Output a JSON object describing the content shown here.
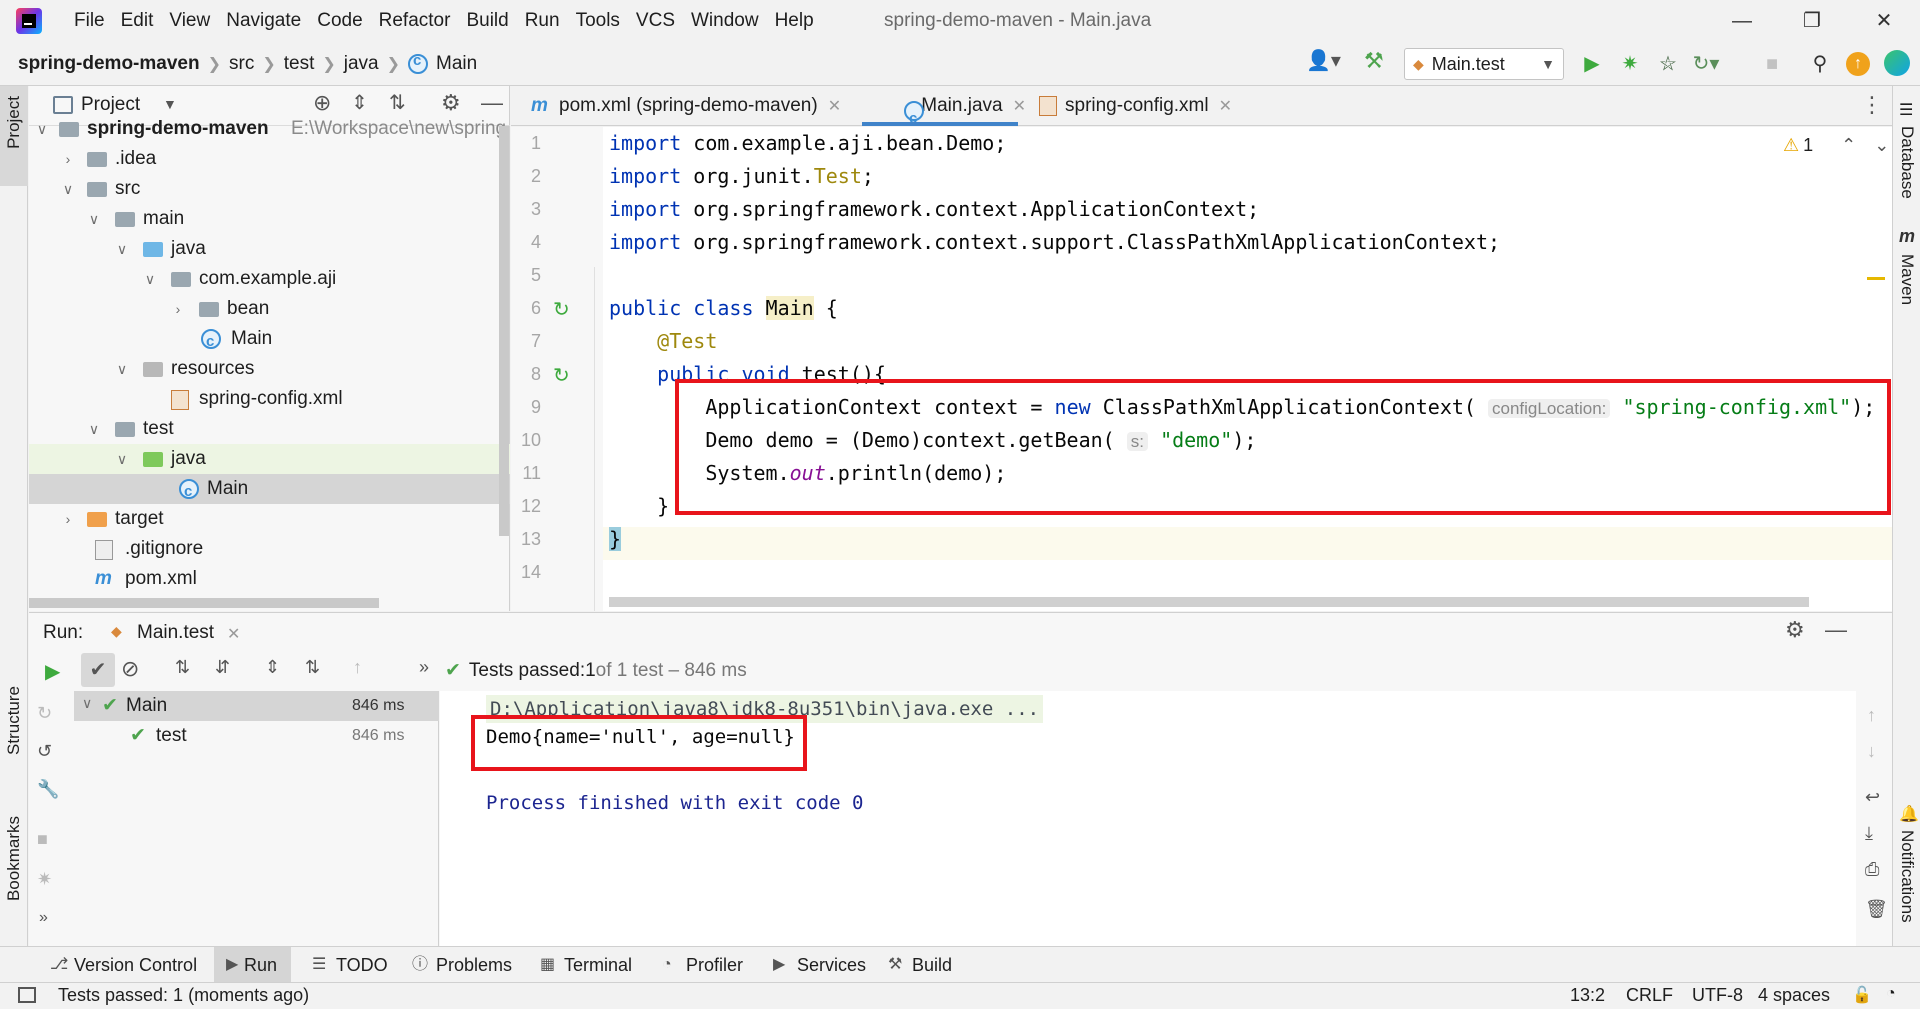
{
  "window": {
    "title": "spring-demo-maven - Main.java"
  },
  "menu": [
    "File",
    "Edit",
    "View",
    "Navigate",
    "Code",
    "Refactor",
    "Build",
    "Run",
    "Tools",
    "VCS",
    "Window",
    "Help"
  ],
  "breadcrumb": [
    "spring-demo-maven",
    "src",
    "test",
    "java",
    "Main"
  ],
  "run_config": "Main.test",
  "project": {
    "header": "Project",
    "tree": [
      {
        "label": "spring-demo-maven",
        "path": "E:\\Workspace\\new\\spring",
        "depth": 0,
        "arrow": "down",
        "icon": "module-folder"
      },
      {
        "label": ".idea",
        "depth": 1,
        "arrow": "right",
        "icon": "folder"
      },
      {
        "label": "src",
        "depth": 1,
        "arrow": "down",
        "icon": "folder"
      },
      {
        "label": "main",
        "depth": 2,
        "arrow": "down",
        "icon": "folder"
      },
      {
        "label": "java",
        "depth": 3,
        "arrow": "down",
        "icon": "source-folder"
      },
      {
        "label": "com.example.aji",
        "depth": 4,
        "arrow": "down",
        "icon": "package"
      },
      {
        "label": "bean",
        "depth": 5,
        "arrow": "right",
        "icon": "package"
      },
      {
        "label": "Main",
        "depth": 5,
        "arrow": "",
        "icon": "class"
      },
      {
        "label": "resources",
        "depth": 3,
        "arrow": "down",
        "icon": "resources-folder"
      },
      {
        "label": "spring-config.xml",
        "depth": 4,
        "arrow": "",
        "icon": "xml-file"
      },
      {
        "label": "test",
        "depth": 2,
        "arrow": "down",
        "icon": "folder"
      },
      {
        "label": "java",
        "depth": 3,
        "arrow": "down",
        "icon": "test-folder"
      },
      {
        "label": "Main",
        "depth": 4,
        "arrow": "",
        "icon": "class"
      },
      {
        "label": "target",
        "depth": 1,
        "arrow": "right",
        "icon": "excluded-folder"
      },
      {
        "label": ".gitignore",
        "depth": 1,
        "arrow": "",
        "icon": "gitignore-file"
      },
      {
        "label": "pom.xml",
        "depth": 1,
        "arrow": "",
        "icon": "maven-file"
      }
    ]
  },
  "editor": {
    "tabs": [
      {
        "label": "pom.xml (spring-demo-maven)",
        "icon": "maven-icon",
        "active": false
      },
      {
        "label": "Main.java",
        "icon": "class-icon",
        "active": true
      },
      {
        "label": "spring-config.xml",
        "icon": "xml-icon",
        "active": false
      }
    ],
    "warning_count": "1",
    "lines": [
      "1",
      "2",
      "3",
      "4",
      "5",
      "6",
      "7",
      "8",
      "9",
      "10",
      "11",
      "12",
      "13",
      "14"
    ],
    "code": {
      "l1_kw": "import",
      "l1_rest": " com.example.aji.bean.Demo;",
      "l2_kw": "import",
      "l2_mid": " org.junit.",
      "l2_cls": "Test",
      "l2_end": ";",
      "l3_kw": "import",
      "l3_rest": " org.springframework.context.ApplicationContext;",
      "l4_kw": "import",
      "l4_rest": " org.springframework.context.support.ClassPathXmlApplicationContext;",
      "l6_kw": "public class",
      "l6_cls": "Main",
      "l6_brace": "{",
      "l7_ann": "@Test",
      "l8_kw": "public void",
      "l8_rest": " test(){",
      "l9_a": "ApplicationContext context = ",
      "l9_kw": "new",
      "l9_b": " ClassPathXmlApplicationContext(",
      "l9_hint": "configLocation:",
      "l9_str": "\"spring-config.xml\"",
      "l9_end": ");",
      "l10_a": "Demo demo = (Demo)context.getBean(",
      "l10_hint": "s:",
      "l10_str": "\"demo\"",
      "l10_end": ");",
      "l11_a": "System.",
      "l11_static": "out",
      "l11_b": ".println(demo);",
      "l12": "}",
      "l13": "}"
    }
  },
  "run": {
    "label": "Run:",
    "tab": "Main.test",
    "summary_prefix": "Tests passed: ",
    "summary_count": "1",
    "summary_rest": " of 1 test – 846 ms",
    "tree": [
      {
        "label": "Main",
        "time": "846 ms"
      },
      {
        "label": "test",
        "time": "846 ms"
      }
    ],
    "console": {
      "cmd": "D:\\Application\\java8\\jdk8-8u351\\bin\\java.exe ...",
      "output": "Demo{name='null', age=null}",
      "exit": "Process finished with exit code 0"
    }
  },
  "tool_tabs": [
    "Version Control",
    "Run",
    "TODO",
    "Problems",
    "Terminal",
    "Profiler",
    "Services",
    "Build"
  ],
  "side_left": [
    "Project",
    "Structure",
    "Bookmarks"
  ],
  "side_right": [
    "Database",
    "Maven",
    "Notifications"
  ],
  "status": {
    "message": "Tests passed: 1 (moments ago)",
    "position": "13:2",
    "line_sep": "CRLF",
    "encoding": "UTF-8",
    "indent": "4 spaces"
  },
  "colors": {
    "keyword": "#0033b3",
    "string": "#067d17",
    "annotation": "#9e880d",
    "highlight_box": "#e8141b",
    "pass": "#4ea44e"
  }
}
